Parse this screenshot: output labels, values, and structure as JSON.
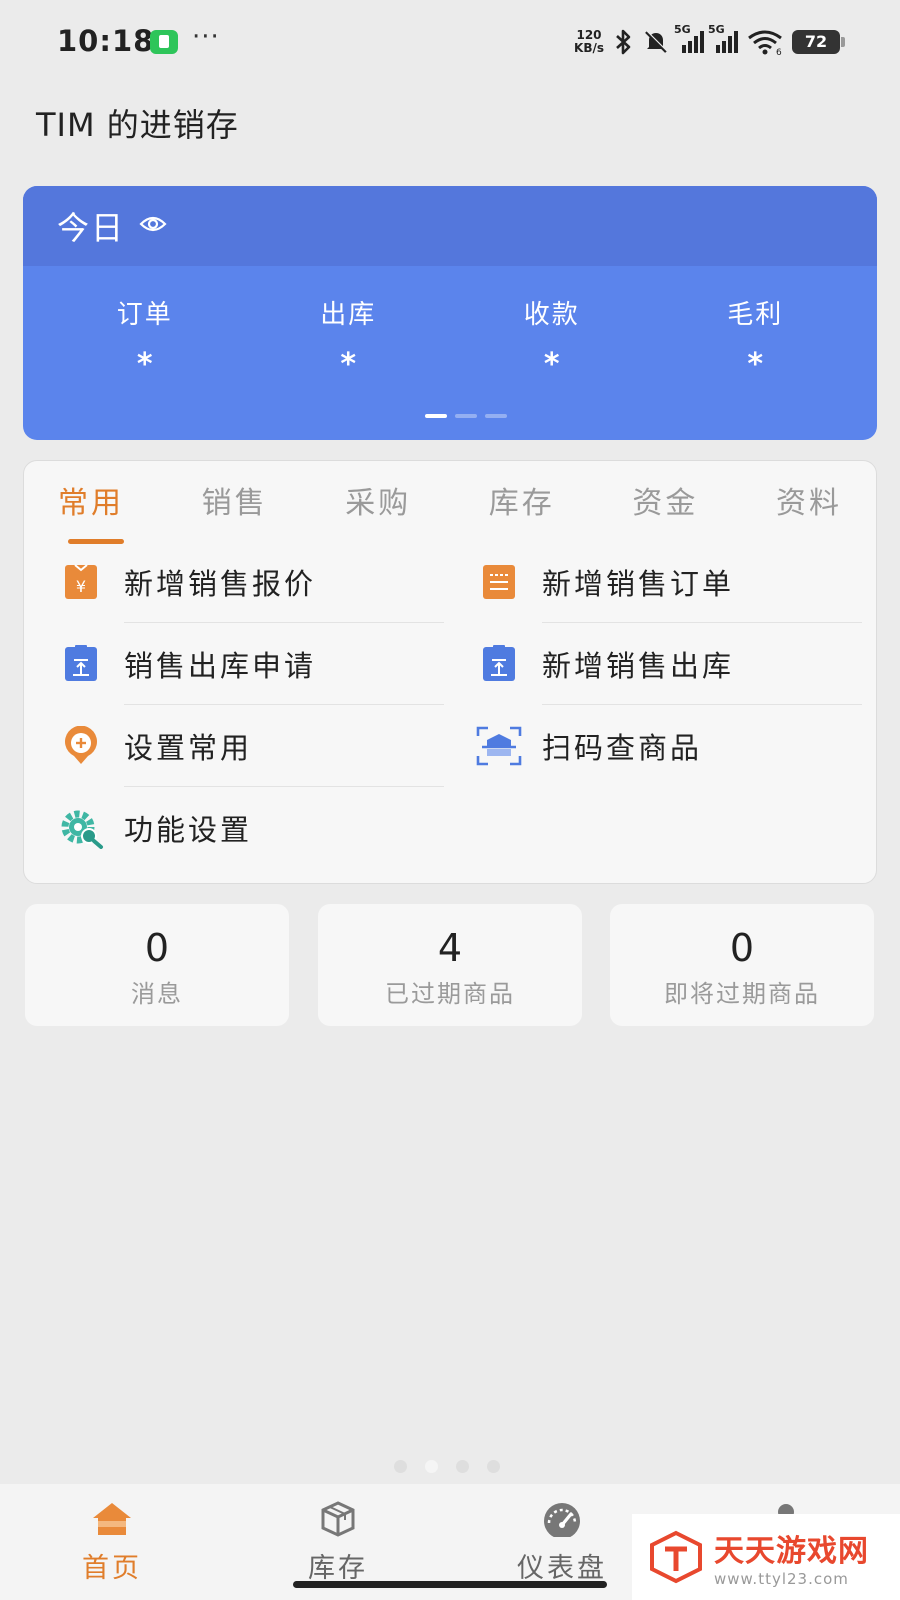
{
  "status_bar": {
    "time": "10:18",
    "dots": "···",
    "speed_value": "120",
    "speed_unit": "KB/s",
    "network_1": "5G",
    "network_2": "5G",
    "wifi_label": "6",
    "battery": "72"
  },
  "header": {
    "title": "TIM 的进销存"
  },
  "today": {
    "title": "今日",
    "stats": [
      {
        "label": "订单",
        "value": "*"
      },
      {
        "label": "出库",
        "value": "*"
      },
      {
        "label": "收款",
        "value": "*"
      },
      {
        "label": "毛利",
        "value": "*"
      }
    ]
  },
  "tabs": [
    "常用",
    "销售",
    "采购",
    "库存",
    "资金",
    "资料"
  ],
  "active_tab": "常用",
  "functions": [
    {
      "label": "新增销售报价",
      "icon": "quote-doc-icon"
    },
    {
      "label": "新增销售订单",
      "icon": "order-doc-icon"
    },
    {
      "label": "销售出库申请",
      "icon": "outbound-request-icon"
    },
    {
      "label": "新增销售出库",
      "icon": "outbound-icon"
    },
    {
      "label": "设置常用",
      "icon": "add-favorite-icon"
    },
    {
      "label": "扫码查商品",
      "icon": "scan-icon"
    },
    {
      "label": "功能设置",
      "icon": "gear-icon"
    }
  ],
  "counters": [
    {
      "value": "0",
      "label": "消息"
    },
    {
      "value": "4",
      "label": "已过期商品"
    },
    {
      "value": "0",
      "label": "即将过期商品"
    }
  ],
  "bottom_nav": [
    {
      "label": "首页",
      "icon": "home-icon"
    },
    {
      "label": "库存",
      "icon": "box-icon"
    },
    {
      "label": "仪表盘",
      "icon": "dashboard-icon"
    },
    {
      "label": "",
      "icon": "user-icon"
    }
  ],
  "watermark": {
    "title": "天天游戏网",
    "url": "www.ttyl23.com"
  },
  "colors": {
    "accent": "#e07d2a",
    "card_blue": "#5b84ec",
    "card_blue_head": "#5477dc",
    "icon_blue": "#4f7be0",
    "icon_teal": "#3fb7a4"
  }
}
